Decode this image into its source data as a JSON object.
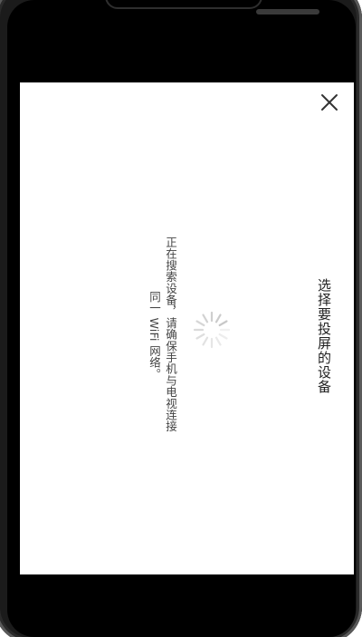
{
  "dialog": {
    "title": "选择要投屏的设备",
    "status_line_1": "正在搜索设备，请确保手机与电视连接",
    "status_line_2": "同一 WiFi 网络。"
  },
  "icons": {
    "close": "close-icon",
    "spinner": "loading-spinner-icon"
  },
  "colors": {
    "dialog_background": "#ffffff",
    "device_background": "#000000",
    "text_primary": "#222222",
    "text_secondary": "#444444",
    "spinner": "#c8c8c8"
  }
}
